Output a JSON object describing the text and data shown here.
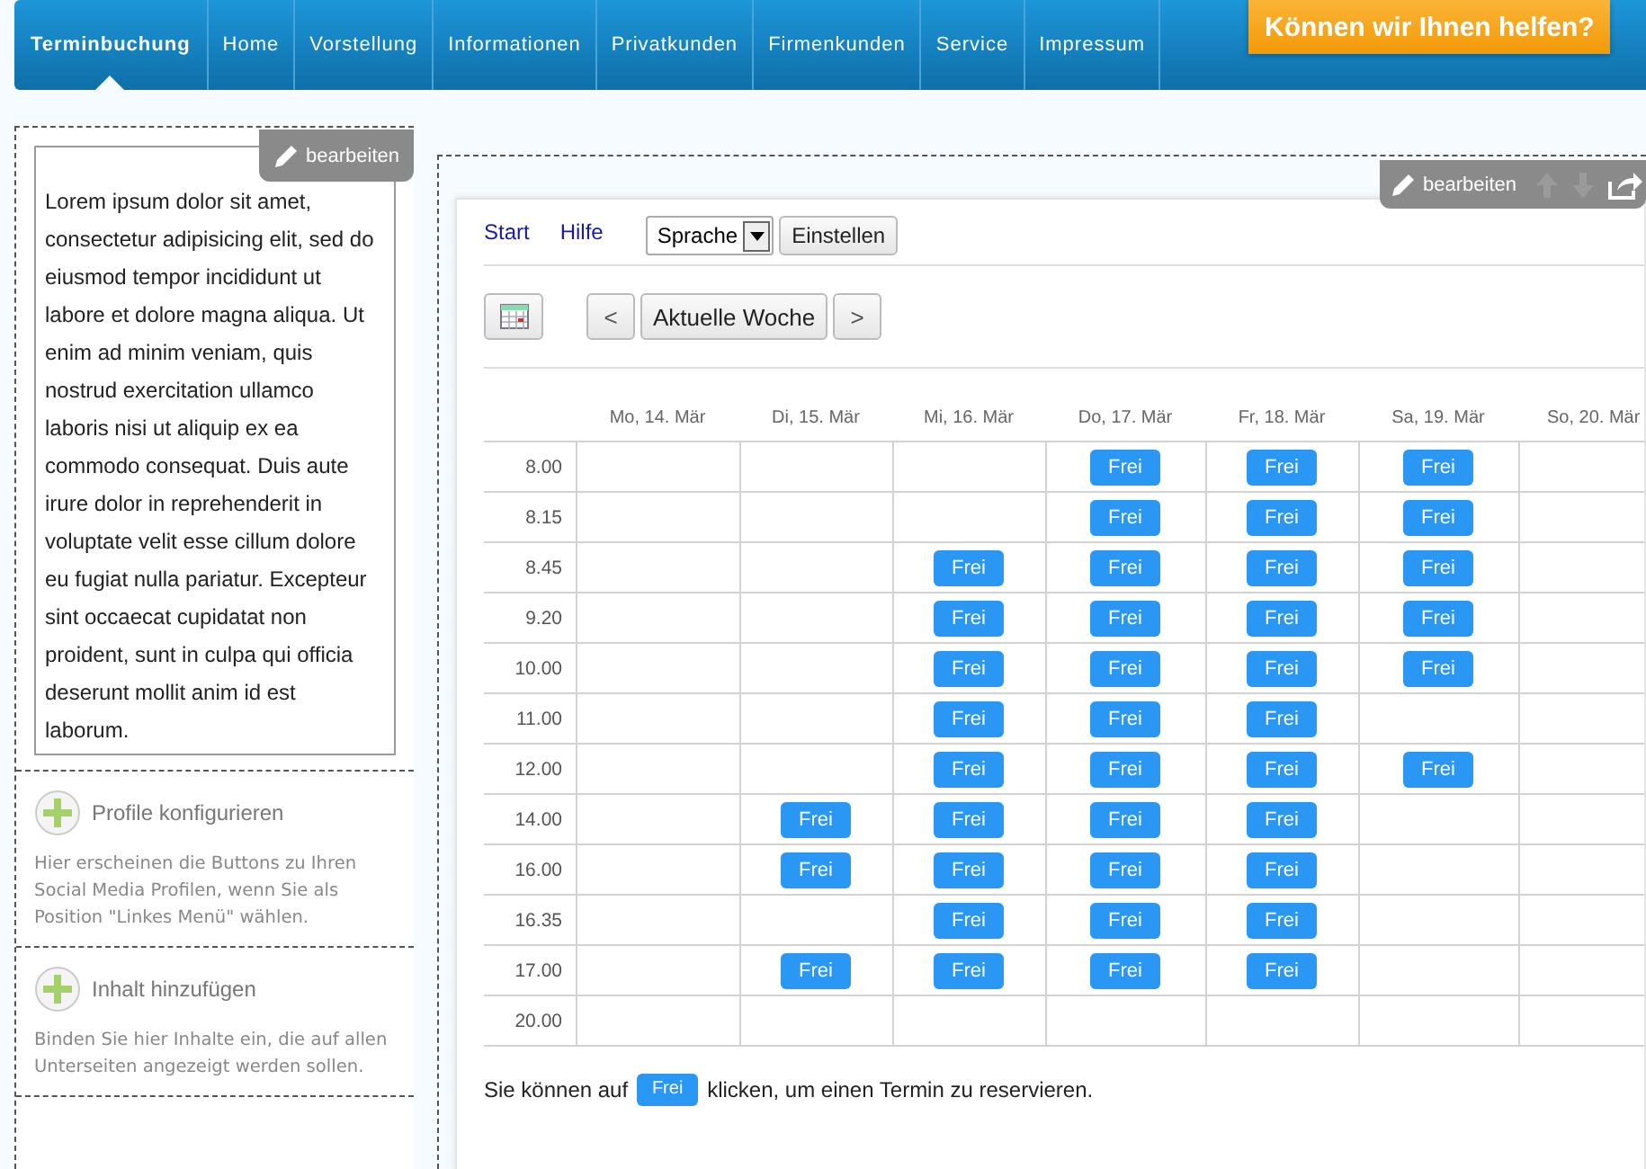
{
  "nav": {
    "items": [
      {
        "label": "Terminbuchung",
        "selected": true
      },
      {
        "label": "Home",
        "selected": false
      },
      {
        "label": "Vorstellung",
        "selected": false
      },
      {
        "label": "Informationen",
        "selected": false
      },
      {
        "label": "Privatkunden",
        "selected": false
      },
      {
        "label": "Firmenkunden",
        "selected": false
      },
      {
        "label": "Service",
        "selected": false
      },
      {
        "label": "Impressum",
        "selected": false
      }
    ],
    "help_button": "Können wir Ihnen helfen?"
  },
  "sidebar": {
    "edit_label": "bearbeiten",
    "text": "Lorem ipsum dolor sit amet, consectetur adipisicing elit, sed do eiusmod tempor incididunt ut labore et dolore magna aliqua. Ut enim ad minim veniam, quis nostrud exercitation ullamco laboris nisi ut aliquip ex ea commodo consequat. Duis aute irure dolor in reprehenderit in voluptate velit esse cillum dolore eu fugiat nulla pariatur. Excepteur sint occaecat cupidatat non proident, sunt in culpa qui officia deserunt mollit anim id est laborum.",
    "widgets": [
      {
        "title": "Profile konfigurieren",
        "description": "Hier erscheinen die Buttons zu Ihren Social Media Profilen, wenn Sie als Position \"Linkes Menü\" wählen."
      },
      {
        "title": "Inhalt hinzufügen",
        "description": "Binden Sie hier Inhalte ein, die auf allen Unterseiten angezeigt werden sollen."
      }
    ]
  },
  "content": {
    "edit_label": "bearbeiten",
    "links": [
      "Start",
      "Hilfe"
    ],
    "language_select": "Sprache",
    "apply_button": "Einstellen",
    "prev_button": "<",
    "week_button": "Aktuelle Woche",
    "next_button": ">",
    "days": [
      "Mo, 14. Mär",
      "Di, 15. Mär",
      "Mi, 16. Mär",
      "Do, 17. Mär",
      "Fr, 18. Mär",
      "Sa, 19. Mär",
      "So, 20. Mär"
    ],
    "rows": [
      {
        "time": "8.00",
        "slots": [
          {
            "free": false
          },
          {
            "free": false
          },
          {
            "free": false
          },
          {
            "free": true,
            "label": "Frei"
          },
          {
            "free": true,
            "label": "Frei"
          },
          {
            "free": true,
            "label": "Frei"
          },
          {
            "free": false
          }
        ]
      },
      {
        "time": "8.15",
        "slots": [
          {
            "free": false
          },
          {
            "free": false
          },
          {
            "free": false
          },
          {
            "free": true,
            "label": "Frei"
          },
          {
            "free": true,
            "label": "Frei"
          },
          {
            "free": true,
            "label": "Frei"
          },
          {
            "free": false
          }
        ]
      },
      {
        "time": "8.45",
        "slots": [
          {
            "free": false
          },
          {
            "free": false
          },
          {
            "free": true,
            "label": "Frei"
          },
          {
            "free": true,
            "label": "Frei"
          },
          {
            "free": true,
            "label": "Frei"
          },
          {
            "free": true,
            "label": "Frei"
          },
          {
            "free": false
          }
        ]
      },
      {
        "time": "9.20",
        "slots": [
          {
            "free": false
          },
          {
            "free": false
          },
          {
            "free": true,
            "label": "Frei"
          },
          {
            "free": true,
            "label": "Frei"
          },
          {
            "free": true,
            "label": "Frei"
          },
          {
            "free": true,
            "label": "Frei"
          },
          {
            "free": false
          }
        ]
      },
      {
        "time": "10.00",
        "slots": [
          {
            "free": false
          },
          {
            "free": false
          },
          {
            "free": true,
            "label": "Frei"
          },
          {
            "free": true,
            "label": "Frei"
          },
          {
            "free": true,
            "label": "Frei"
          },
          {
            "free": true,
            "label": "Frei"
          },
          {
            "free": false
          }
        ]
      },
      {
        "time": "11.00",
        "slots": [
          {
            "free": false
          },
          {
            "free": false
          },
          {
            "free": true,
            "label": "Frei"
          },
          {
            "free": true,
            "label": "Frei"
          },
          {
            "free": true,
            "label": "Frei"
          },
          {
            "free": false
          },
          {
            "free": false
          }
        ]
      },
      {
        "time": "12.00",
        "slots": [
          {
            "free": false
          },
          {
            "free": false
          },
          {
            "free": true,
            "label": "Frei"
          },
          {
            "free": true,
            "label": "Frei"
          },
          {
            "free": true,
            "label": "Frei"
          },
          {
            "free": true,
            "label": "Frei"
          },
          {
            "free": false
          }
        ]
      },
      {
        "time": "14.00",
        "slots": [
          {
            "free": false
          },
          {
            "free": true,
            "label": "Frei"
          },
          {
            "free": true,
            "label": "Frei"
          },
          {
            "free": true,
            "label": "Frei"
          },
          {
            "free": true,
            "label": "Frei"
          },
          {
            "free": false
          },
          {
            "free": false
          }
        ]
      },
      {
        "time": "16.00",
        "slots": [
          {
            "free": false
          },
          {
            "free": true,
            "label": "Frei"
          },
          {
            "free": true,
            "label": "Frei"
          },
          {
            "free": true,
            "label": "Frei"
          },
          {
            "free": true,
            "label": "Frei"
          },
          {
            "free": false
          },
          {
            "free": false
          }
        ]
      },
      {
        "time": "16.35",
        "slots": [
          {
            "free": false
          },
          {
            "free": false
          },
          {
            "free": true,
            "label": "Frei"
          },
          {
            "free": true,
            "label": "Frei"
          },
          {
            "free": true,
            "label": "Frei"
          },
          {
            "free": false
          },
          {
            "free": false
          }
        ]
      },
      {
        "time": "17.00",
        "slots": [
          {
            "free": false
          },
          {
            "free": true,
            "label": "Frei"
          },
          {
            "free": true,
            "label": "Frei"
          },
          {
            "free": true,
            "label": "Frei"
          },
          {
            "free": true,
            "label": "Frei"
          },
          {
            "free": false
          },
          {
            "free": false
          }
        ]
      },
      {
        "time": "20.00",
        "slots": [
          {
            "free": false
          },
          {
            "free": false
          },
          {
            "free": false
          },
          {
            "free": false
          },
          {
            "free": false
          },
          {
            "free": false
          },
          {
            "free": false
          }
        ]
      }
    ],
    "hint_before": "Sie können auf",
    "hint_button": "Frei",
    "hint_after": "klicken, um einen Termin zu reservieren."
  }
}
